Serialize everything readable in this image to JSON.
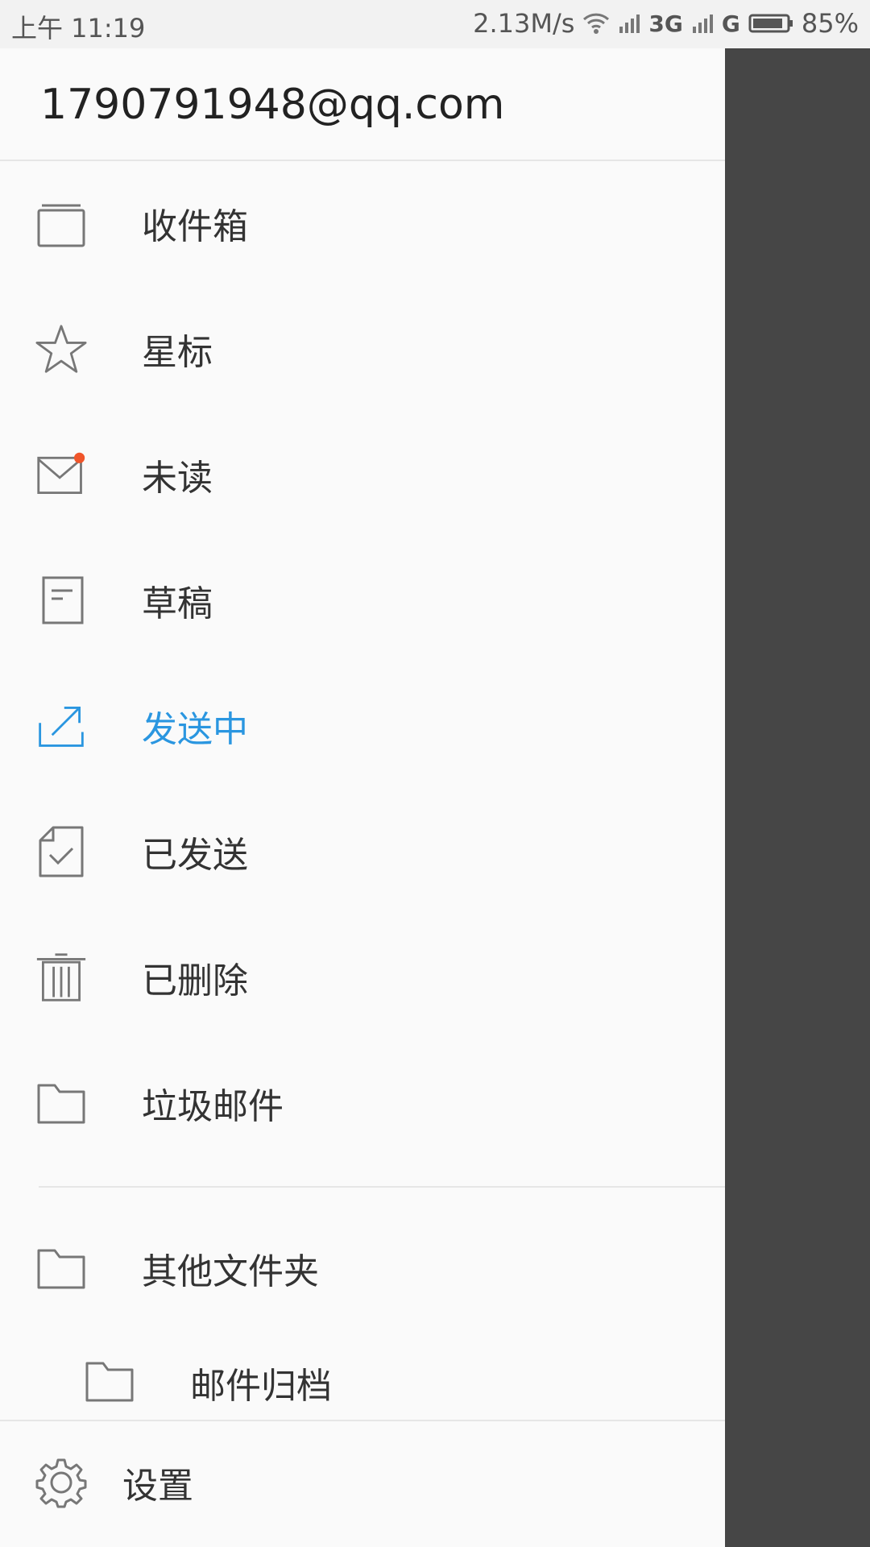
{
  "status_bar": {
    "time": "上午 11:19",
    "net_speed": "2.13M/s",
    "network_3g": "3G",
    "network_g": "G",
    "battery": "85%"
  },
  "drawer": {
    "account_email": "1790791948@qq.com",
    "folders": [
      {
        "label": "收件箱",
        "icon": "inbox-icon"
      },
      {
        "label": "星标",
        "icon": "star-icon"
      },
      {
        "label": "未读",
        "icon": "mail-unread-icon"
      },
      {
        "label": "草稿",
        "icon": "draft-icon"
      },
      {
        "label": "发送中",
        "icon": "sending-icon"
      },
      {
        "label": "已发送",
        "icon": "sent-icon"
      },
      {
        "label": "已删除",
        "icon": "trash-icon"
      },
      {
        "label": "垃圾邮件",
        "icon": "folder-icon"
      }
    ],
    "other_folders_label": "其他文件夹",
    "sub_folders": [
      {
        "label": "邮件归档",
        "icon": "folder-icon"
      }
    ],
    "settings_label": "设置"
  },
  "colors": {
    "accent": "#2a96e0",
    "unread_dot": "#f0552a",
    "scrim": "#464646",
    "drawer_bg": "#fafafa"
  }
}
